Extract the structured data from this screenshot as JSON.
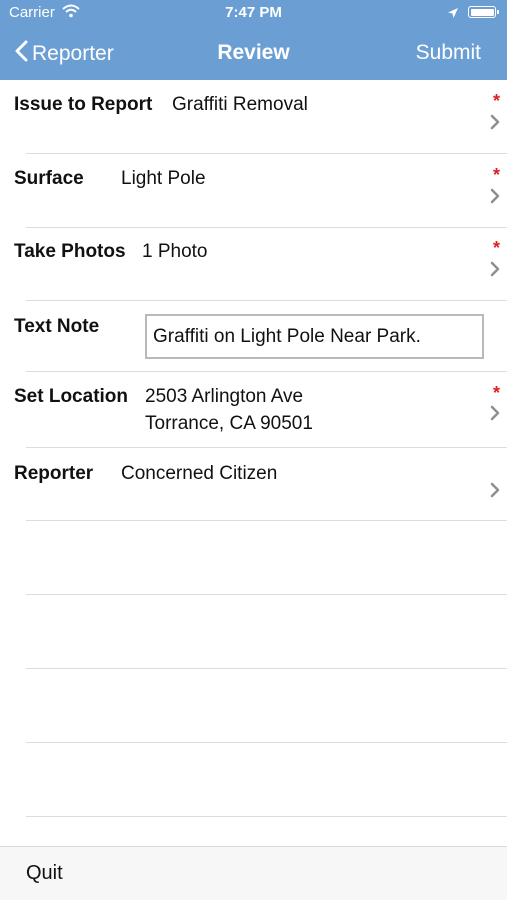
{
  "status": {
    "carrier": "Carrier",
    "time": "7:47 PM"
  },
  "nav": {
    "back_label": "Reporter",
    "title": "Review",
    "submit_label": "Submit"
  },
  "rows": [
    {
      "label": "Issue to Report",
      "value": "Graffiti Removal",
      "required": true
    },
    {
      "label": "Surface",
      "value": "Light Pole",
      "required": true
    },
    {
      "label": "Take Photos",
      "value": "1 Photo",
      "required": true
    },
    {
      "label": "Text Note",
      "value": "Graffiti on Light Pole Near Park.",
      "required": false
    },
    {
      "label": "Set Location",
      "value_line1": "2503 Arlington Ave",
      "value_line2": "Torrance, CA 90501",
      "required": true
    },
    {
      "label": "Reporter",
      "value": "Concerned Citizen",
      "required": false
    }
  ],
  "required_marker": "*",
  "footer": {
    "quit_label": "Quit"
  },
  "colors": {
    "header_bg": "#6b9fd3",
    "required": "#e02020",
    "chevron": "#8e8e93"
  },
  "icons": {
    "back": "chevron-left-icon",
    "disclosure": "chevron-right-icon",
    "wifi": "wifi-icon",
    "location": "location-arrow-icon",
    "battery": "battery-icon"
  }
}
